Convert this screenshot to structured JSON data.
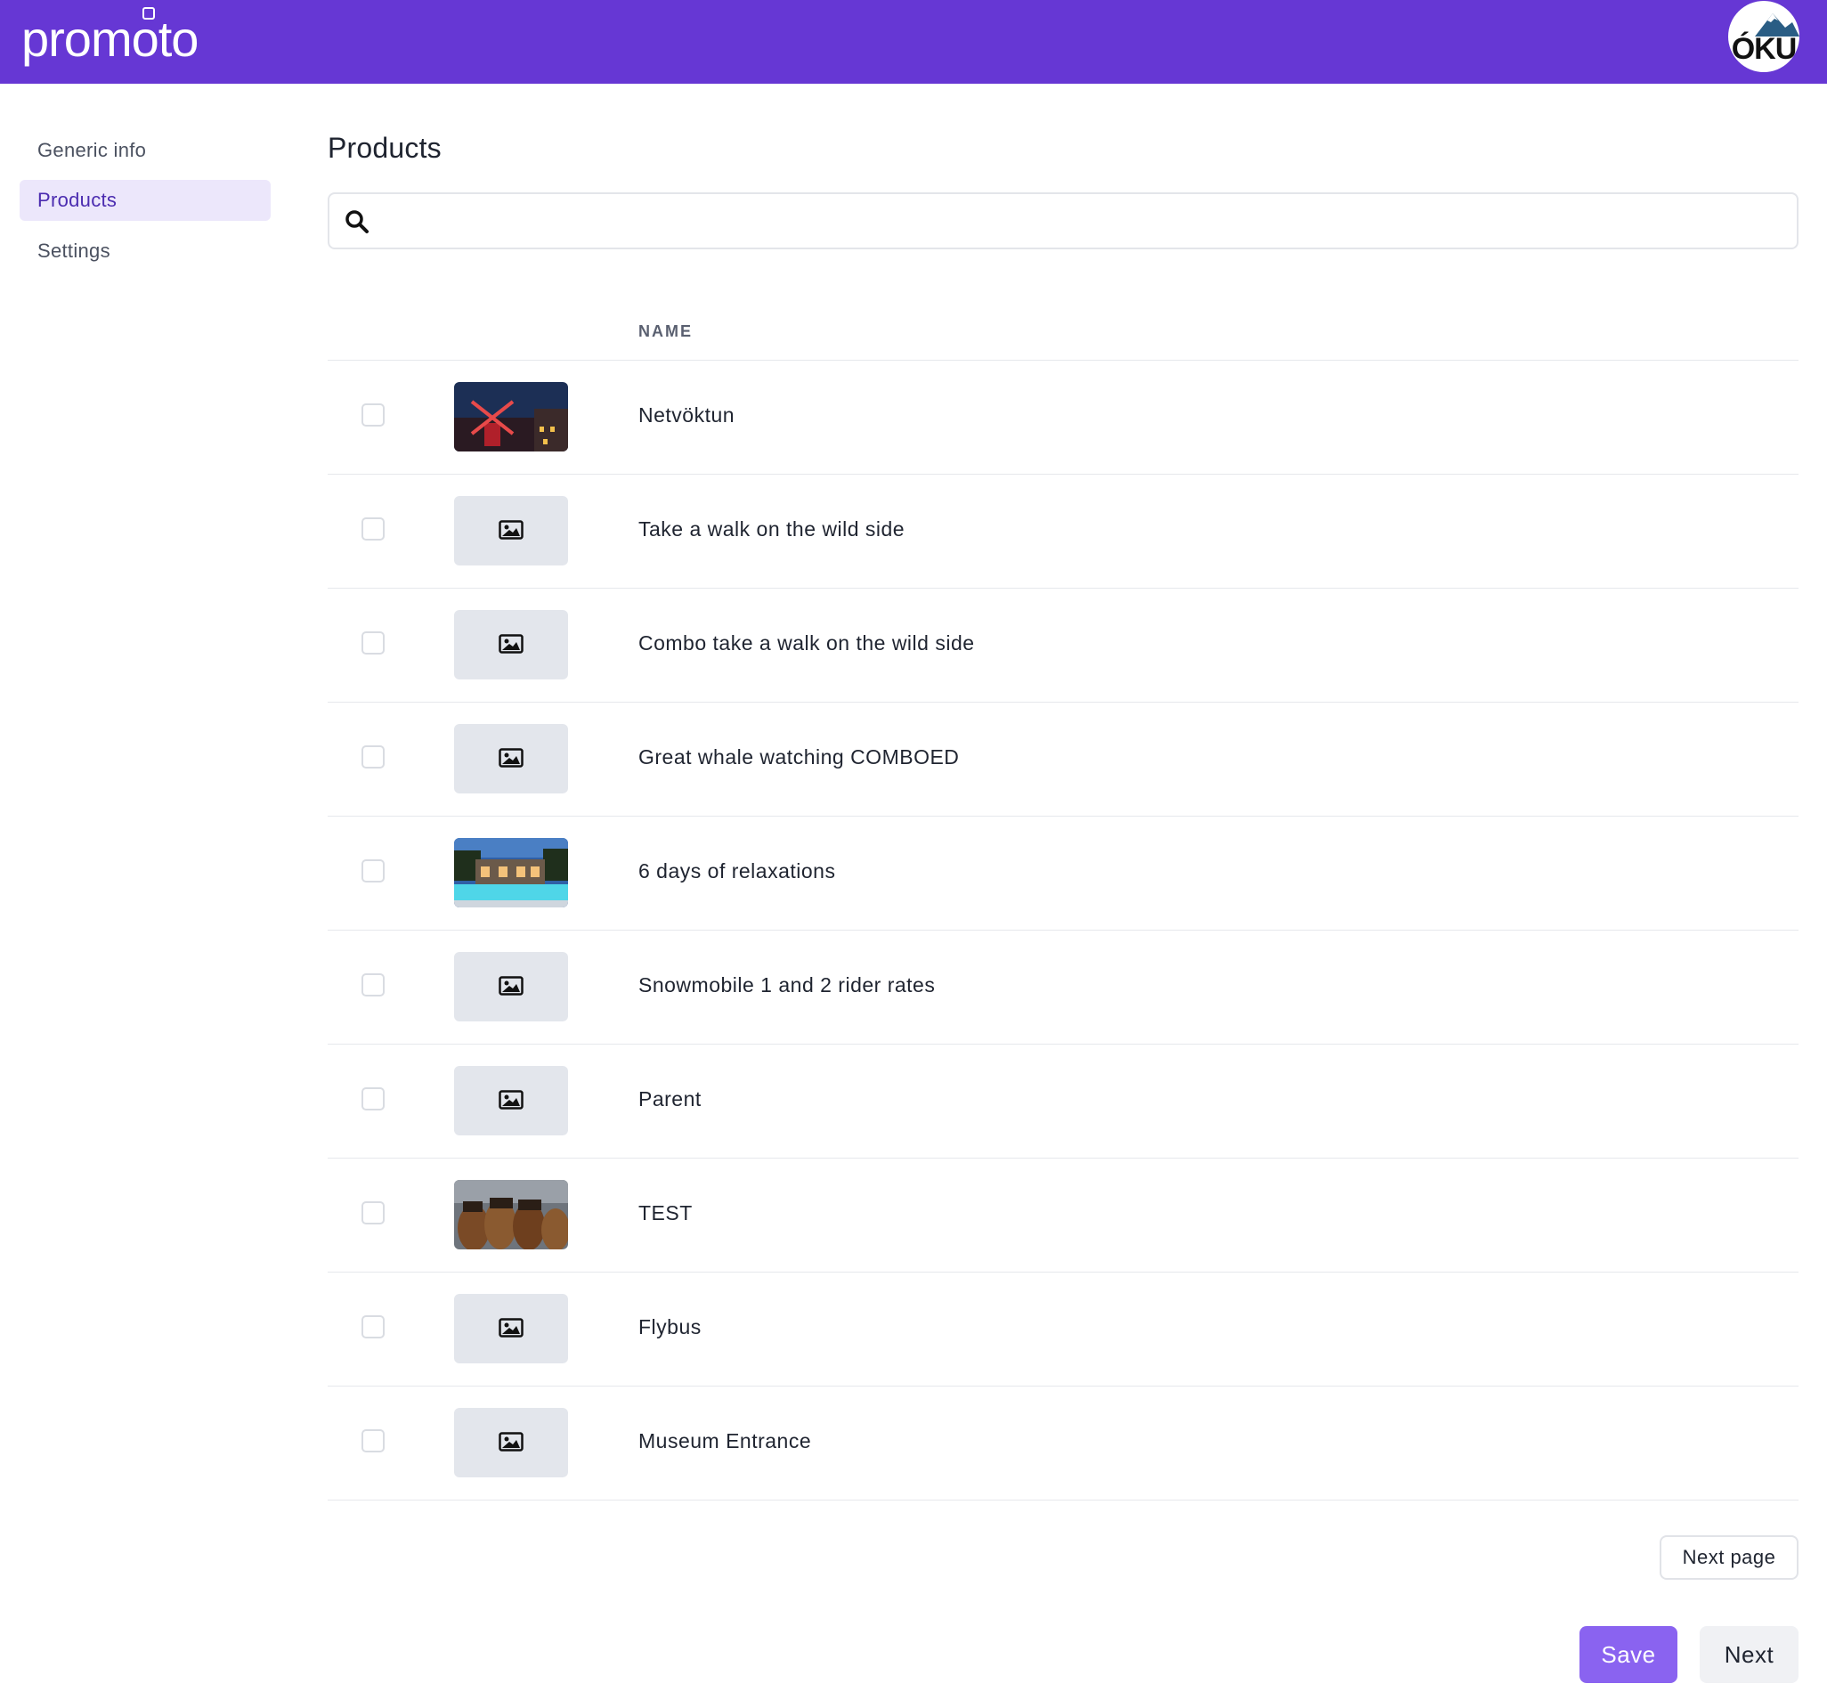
{
  "app": {
    "brand": "promoto",
    "avatar_text": "ÓKU"
  },
  "sidebar": {
    "items": [
      {
        "label": "Generic info",
        "active": false
      },
      {
        "label": "Products",
        "active": true
      },
      {
        "label": "Settings",
        "active": false
      }
    ]
  },
  "main": {
    "title": "Products",
    "search": {
      "placeholder": "",
      "value": "",
      "icon": "search-icon"
    },
    "table": {
      "columns": [
        "NAME"
      ],
      "rows": [
        {
          "name": "Netvöktun",
          "checked": false,
          "thumbnail": "windmill-photo"
        },
        {
          "name": "Take a walk on the wild side",
          "checked": false,
          "thumbnail": "placeholder-image-icon"
        },
        {
          "name": "Combo take a walk on the wild side",
          "checked": false,
          "thumbnail": "placeholder-image-icon"
        },
        {
          "name": "Great whale watching COMBOED",
          "checked": false,
          "thumbnail": "placeholder-image-icon"
        },
        {
          "name": "6 days of relaxations",
          "checked": false,
          "thumbnail": "pool-photo"
        },
        {
          "name": "Snowmobile 1 and 2 rider rates",
          "checked": false,
          "thumbnail": "placeholder-image-icon"
        },
        {
          "name": "Parent",
          "checked": false,
          "thumbnail": "placeholder-image-icon"
        },
        {
          "name": "TEST",
          "checked": false,
          "thumbnail": "horses-photo"
        },
        {
          "name": "Flybus",
          "checked": false,
          "thumbnail": "placeholder-image-icon"
        },
        {
          "name": "Museum Entrance",
          "checked": false,
          "thumbnail": "placeholder-image-icon"
        }
      ]
    },
    "pagination": {
      "next_page_label": "Next page"
    }
  },
  "footer": {
    "save_label": "Save",
    "next_label": "Next"
  },
  "colors": {
    "header": "#6637d4",
    "accent": "#8a63f0",
    "active_nav_bg": "#ece7fb",
    "active_nav_text": "#4b2cb0"
  }
}
